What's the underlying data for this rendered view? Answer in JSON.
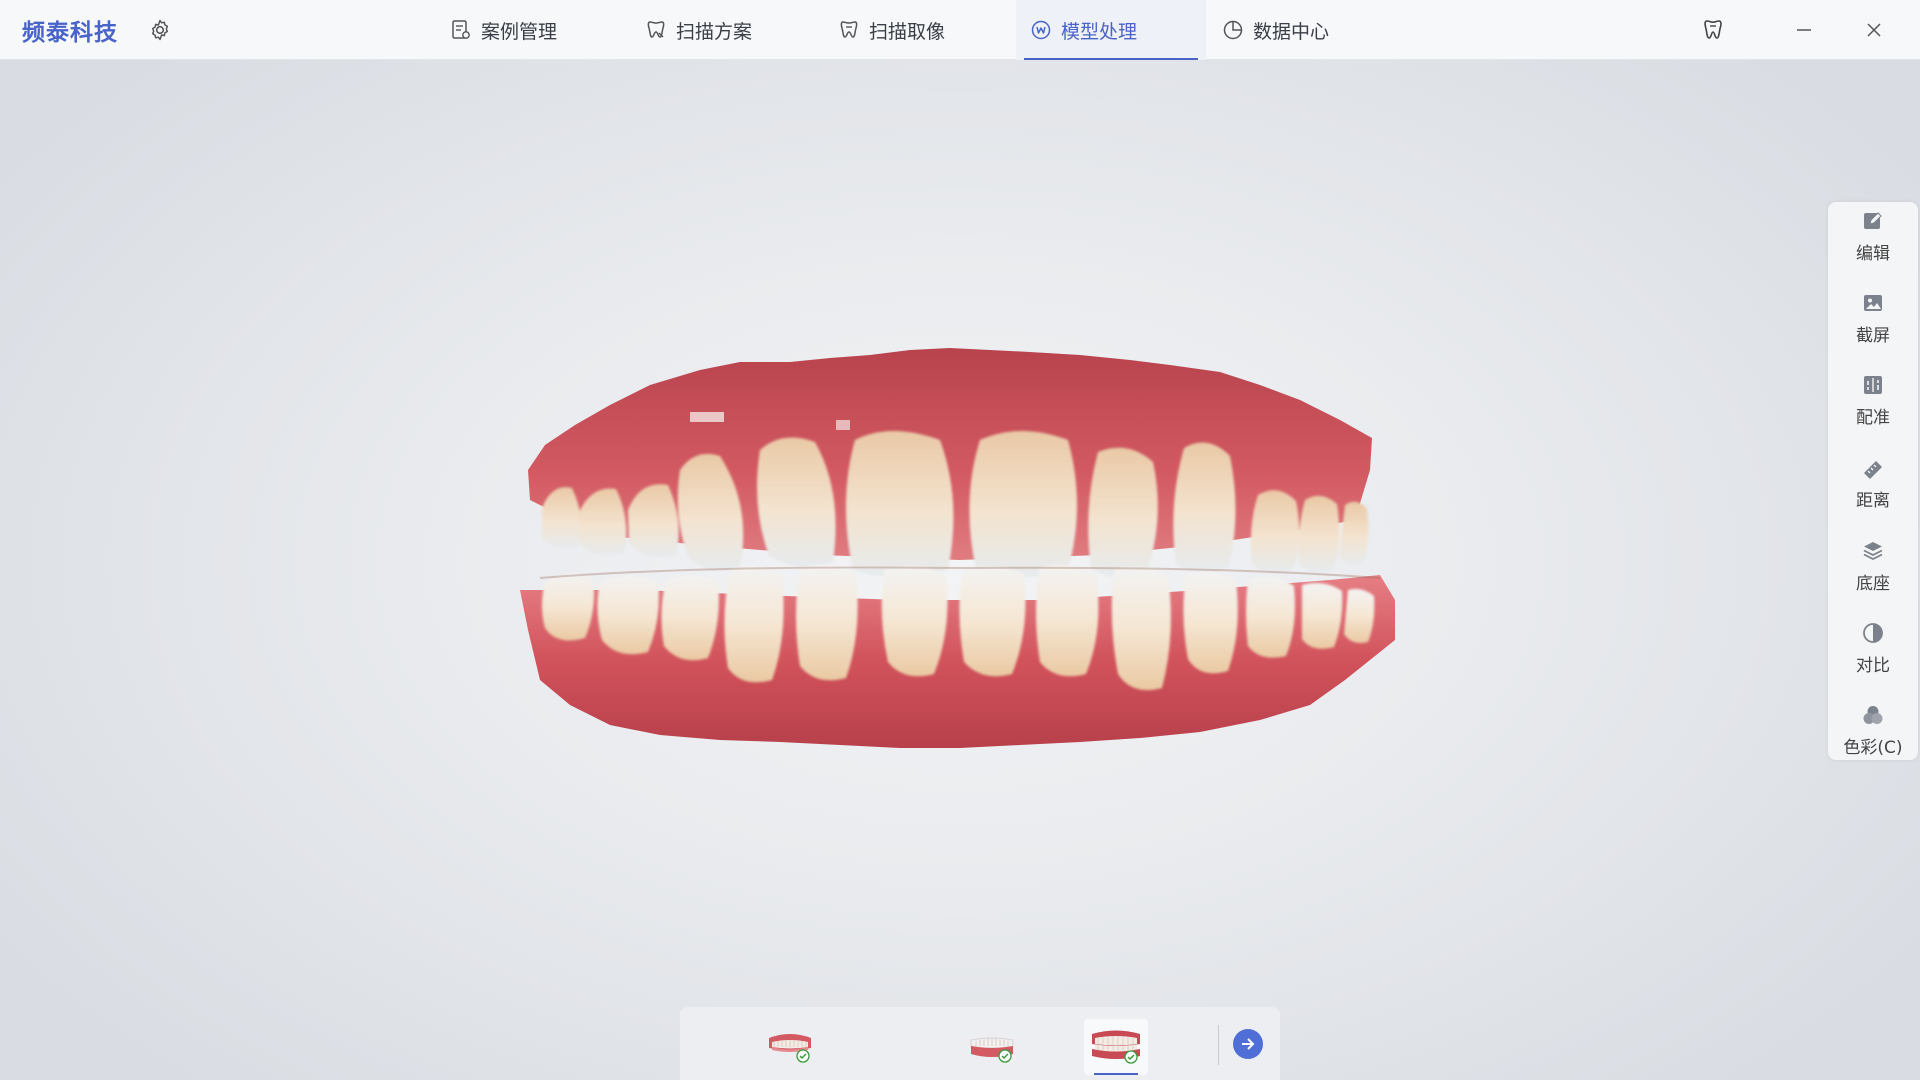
{
  "app": {
    "brand": "频泰科技"
  },
  "tabs": [
    {
      "label": "案例管理",
      "icon": "case-list-icon"
    },
    {
      "label": "扫描方案",
      "icon": "tooth-plan-icon"
    },
    {
      "label": "扫描取像",
      "icon": "tooth-scan-icon"
    },
    {
      "label": "模型处理",
      "icon": "model-process-icon",
      "active": true
    },
    {
      "label": "数据中心",
      "icon": "pie-chart-icon"
    }
  ],
  "right_toolbar": [
    {
      "label": "编辑",
      "icon": "edit-icon"
    },
    {
      "label": "截屏",
      "icon": "screenshot-icon"
    },
    {
      "label": "配准",
      "icon": "registration-icon"
    },
    {
      "label": "距离",
      "icon": "ruler-icon"
    },
    {
      "label": "底座",
      "icon": "layers-icon"
    },
    {
      "label": "对比",
      "icon": "contrast-icon"
    },
    {
      "label": "色彩(C)",
      "icon": "color-icon"
    }
  ],
  "bottom_bar": {
    "items": [
      {
        "icon": "upper-jaw-icon",
        "done": true
      },
      {
        "icon": "lower-jaw-icon",
        "done": true
      },
      {
        "icon": "bite-jaw-icon",
        "done": true,
        "selected": true
      }
    ],
    "next_icon": "arrow-right-icon"
  },
  "colors": {
    "accent": "#4a63c9",
    "gum": "#c84a55",
    "tooth": "#f1ddc4"
  }
}
